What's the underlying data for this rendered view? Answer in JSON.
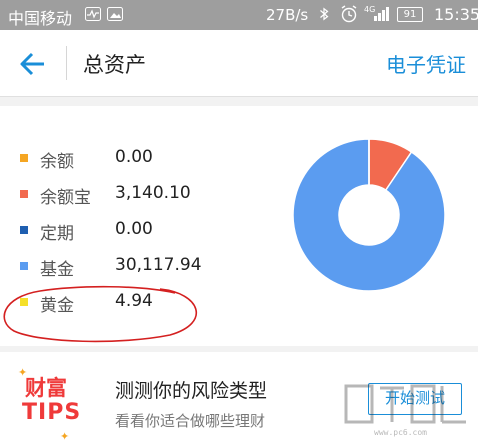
{
  "status_bar": {
    "carrier": "中国移动",
    "speed": "27B/s",
    "battery": "91",
    "time": "15:35",
    "icons": [
      "activity-icon",
      "image-icon",
      "bluetooth-icon",
      "alarm-icon",
      "signal-4g-icon",
      "battery-icon"
    ]
  },
  "header": {
    "back_icon": "arrow-left-icon",
    "title": "总资产",
    "action": "电子凭证",
    "accent_color": "#1a8ed8"
  },
  "assets": {
    "items": [
      {
        "label": "余额",
        "value": "0.00",
        "color": "#f5a623"
      },
      {
        "label": "余额宝",
        "value": "3,140.10",
        "color": "#f26a4f"
      },
      {
        "label": "定期",
        "value": "0.00",
        "color": "#1f5fb0"
      },
      {
        "label": "基金",
        "value": "30,117.94",
        "color": "#5b9cf0"
      },
      {
        "label": "黄金",
        "value": "4.94",
        "color": "#f5e02a"
      }
    ],
    "annotation": {
      "target": "黄金",
      "shape": "red-ellipse",
      "color": "#d42020"
    }
  },
  "chart_data": {
    "type": "pie",
    "donut": true,
    "categories": [
      "余额",
      "余额宝",
      "定期",
      "基金",
      "黄金"
    ],
    "values": [
      0.0,
      3140.1,
      0.0,
      30117.94,
      4.94
    ],
    "colors": [
      "#f5a623",
      "#f26a4f",
      "#1f5fb0",
      "#5b9cf0",
      "#f5e02a"
    ]
  },
  "tips": {
    "logo": {
      "top": "财富",
      "bottom": "TIPS"
    },
    "title": "测测你的风险类型",
    "subtitle": "看看你适合做哪些理财",
    "button": "开始测试"
  },
  "watermark": {
    "text": "www.pc6.com"
  }
}
